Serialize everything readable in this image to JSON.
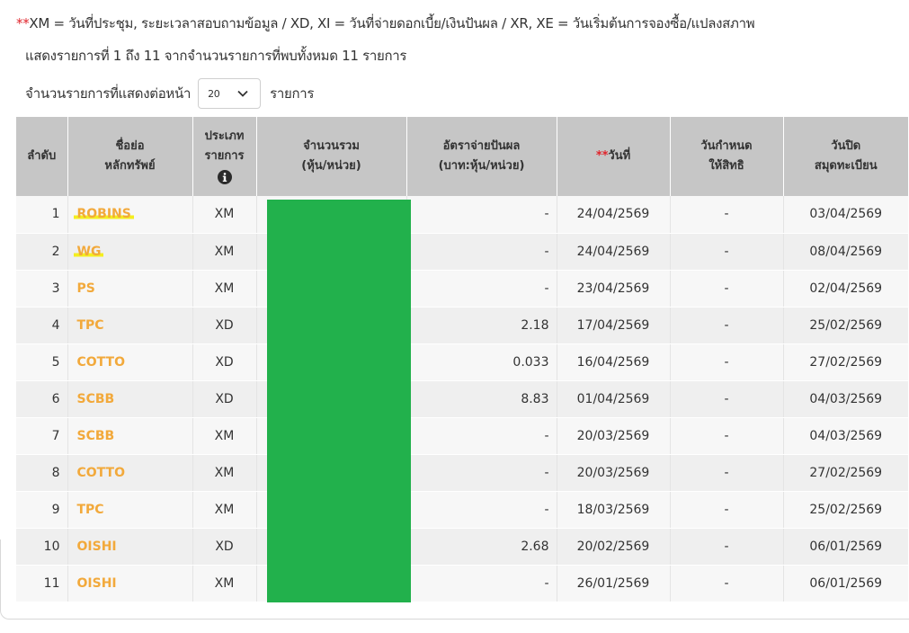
{
  "note": {
    "star": "**",
    "text": "XM = วันที่ประชุม, ระยะเวลาสอบถามข้อมูล / XD, XI = วันที่จ่ายดอกเบี้ย/เงินปันผล / XR, XE = วันเริ่มต้นการจองซื้อ/แปลงสภาพ"
  },
  "summary": "แสดงรายการที่ 1 ถึง 11 จากจำนวนรายการที่พบทั้งหมด 11 รายการ",
  "page_size": {
    "label": "จำนวนรายการที่แสดงต่อหน้า",
    "value": "20",
    "suffix": "รายการ"
  },
  "table": {
    "headers": {
      "no": "ลำดับ",
      "symbol": "ชื่อย่อ\nหลักทรัพย์",
      "type": "ประเภท\nรายการ",
      "volume": "จำนวนรวม\n(หุ้น/หน่วย)",
      "rate": "อัตราจ่ายปันผล\n(บาท:หุ้น/หน่วย)",
      "date_star": "**",
      "date": "วันที่",
      "record_date": "วันกำหนด\nให้สิทธิ",
      "book_close": "วันปิด\nสมุดทะเบียน"
    },
    "rows": [
      {
        "no": "1",
        "symbol": "ROBINS",
        "type": "XM",
        "rate": "-",
        "date": "24/04/2569",
        "record": "-",
        "close": "03/04/2569",
        "highlight": true
      },
      {
        "no": "2",
        "symbol": "WG",
        "type": "XM",
        "rate": "-",
        "date": "24/04/2569",
        "record": "-",
        "close": "08/04/2569",
        "highlight": true
      },
      {
        "no": "3",
        "symbol": "PS",
        "type": "XM",
        "rate": "-",
        "date": "23/04/2569",
        "record": "-",
        "close": "02/04/2569",
        "highlight": false
      },
      {
        "no": "4",
        "symbol": "TPC",
        "type": "XD",
        "rate": "2.18",
        "date": "17/04/2569",
        "record": "-",
        "close": "25/02/2569",
        "highlight": false
      },
      {
        "no": "5",
        "symbol": "COTTO",
        "type": "XD",
        "rate": "0.033",
        "date": "16/04/2569",
        "record": "-",
        "close": "27/02/2569",
        "highlight": false
      },
      {
        "no": "6",
        "symbol": "SCBB",
        "type": "XD",
        "rate": "8.83",
        "date": "01/04/2569",
        "record": "-",
        "close": "04/03/2569",
        "highlight": false
      },
      {
        "no": "7",
        "symbol": "SCBB",
        "type": "XM",
        "rate": "-",
        "date": "20/03/2569",
        "record": "-",
        "close": "04/03/2569",
        "highlight": false
      },
      {
        "no": "8",
        "symbol": "COTTO",
        "type": "XM",
        "rate": "-",
        "date": "20/03/2569",
        "record": "-",
        "close": "27/02/2569",
        "highlight": false
      },
      {
        "no": "9",
        "symbol": "TPC",
        "type": "XM",
        "rate": "-",
        "date": "18/03/2569",
        "record": "-",
        "close": "25/02/2569",
        "highlight": false
      },
      {
        "no": "10",
        "symbol": "OISHI",
        "type": "XD",
        "rate": "2.68",
        "date": "20/02/2569",
        "record": "-",
        "close": "06/01/2569",
        "highlight": false
      },
      {
        "no": "11",
        "symbol": "OISHI",
        "type": "XM",
        "rate": "-",
        "date": "26/01/2569",
        "record": "-",
        "close": "06/01/2569",
        "highlight": false
      }
    ]
  },
  "colors": {
    "symbol_link": "#f2a93b",
    "header_bg": "#c6c6c6",
    "mask": "#22b14c",
    "star": "#e0242b",
    "highlight": "#f4ee1f"
  },
  "icons": {
    "type_info": "info-icon",
    "select_caret": "chevron-down-icon"
  }
}
